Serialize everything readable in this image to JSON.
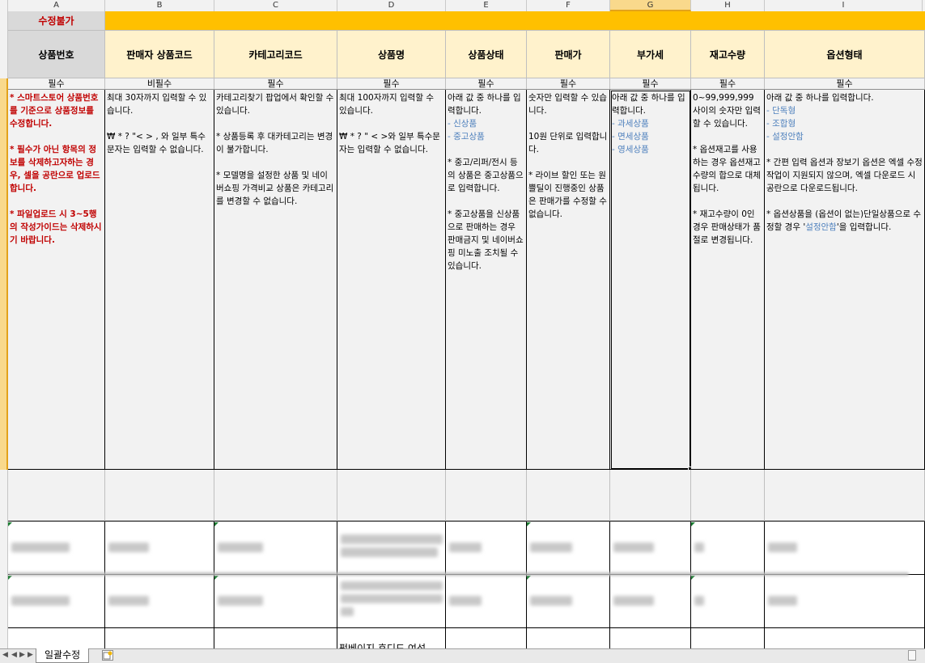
{
  "columns": [
    "A",
    "B",
    "C",
    "D",
    "E",
    "F",
    "G",
    "H",
    "I"
  ],
  "top_banner": "수정불가",
  "headers": {
    "A": "상품번호",
    "B": "판매자 상품코드",
    "C": "카테고리코드",
    "D": "상품명",
    "E": "상품상태",
    "F": "판매가",
    "G": "부가세",
    "H": "재고수량",
    "I": "옵션형태"
  },
  "required": {
    "A": "필수",
    "B": "비필수",
    "C": "필수",
    "D": "필수",
    "E": "필수",
    "F": "필수",
    "G": "필수",
    "H": "필수",
    "I": "필수"
  },
  "guides": {
    "A": {
      "p1": "* 스마트스토어 상품번호를 기준으로 상품정보를 수정합니다.",
      "p2": "* 필수가 아닌 항목의 정보를 삭제하고자하는 경우, 셀을 공란으로 업로드합니다.",
      "p3": "* 파일업로드 시 3~5행의 작성가이드는 삭제하시기 바랍니다."
    },
    "B": {
      "p1": "최대 30자까지 입력할 수 있습니다.",
      "p2": "₩ * ? \"< > , 와 일부 특수문자는 입력할 수 없습니다."
    },
    "C": {
      "p1": "카테고리찾기 팝업에서 확인할 수 있습니다.",
      "p2": "* 상품등록 후 대카테고리는 변경이 불가합니다.",
      "p3": "* 모델명을 설정한 상품 및 네이버쇼핑 가격비교 상품은 카테고리를 변경할 수 없습니다."
    },
    "D": {
      "p1": "최대 100자까지 입력할 수 있습니다.",
      "p2": "₩ * ? \" < >와 일부 특수문자는 입력할 수 없습니다."
    },
    "E": {
      "intro": "아래 값 중 하나를 입력합니다.",
      "opt1": "- 신상품",
      "opt2": "- 중고상품",
      "p2": "* 중고/리퍼/전시 등의 상품은 중고상품으로 입력합니다.",
      "p3": "* 중고상품을 신상품으로 판매하는 경우 판매금지 및 네이버쇼핑 미노출 조치될 수 있습니다."
    },
    "F": {
      "p1": "숫자만 입력할 수 있습니다.",
      "p2": "10원 단위로 입력합니다.",
      "p3": "* 라이브 할인 또는 원쁠딜이 진행중인 상품은 판매가를 수정할 수 없습니다."
    },
    "G": {
      "intro": "아래 값 중 하나를 입력합니다.",
      "opt1": "- 과세상품",
      "opt2": "- 면세상품",
      "opt3": "- 영세상품"
    },
    "H": {
      "p1": "0~99,999,999 사이의 숫자만 입력할 수 있습니다.",
      "p2": "* 옵션재고를 사용하는 경우 옵션재고수량의 합으로 대체됩니다.",
      "p3": "* 재고수량이 0인경우 판매상태가 품절로 변경됩니다."
    },
    "I": {
      "intro": "아래 값 중 하나를 입력합니다.",
      "opt1": "- 단독형",
      "opt2": "- 조합형",
      "opt3": "- 설정안함",
      "p2": "* 간편 입력 옵션과 장보기 옵션은 엑셀 수정작업이 지원되지 않으며, 엑셀 다운로드 시 공란으로 다운로드됩니다.",
      "p3_pre": "* 옵션상품을 (옵션이 없는)단일상품으로 수정할 경우 '",
      "p3_value": "설정안함",
      "p3_post": "'을 입력합니다."
    }
  },
  "visible_data": {
    "row3_D": "펌베이지 후디드 여성"
  },
  "sheet_tab": "일괄수정",
  "colors": {
    "banner_yellow": "#ffc000",
    "header_fill": "#fff2cc",
    "red_text": "#c00000",
    "blue_text": "#4f81bd",
    "guide_fill": "#f2f2f2"
  }
}
